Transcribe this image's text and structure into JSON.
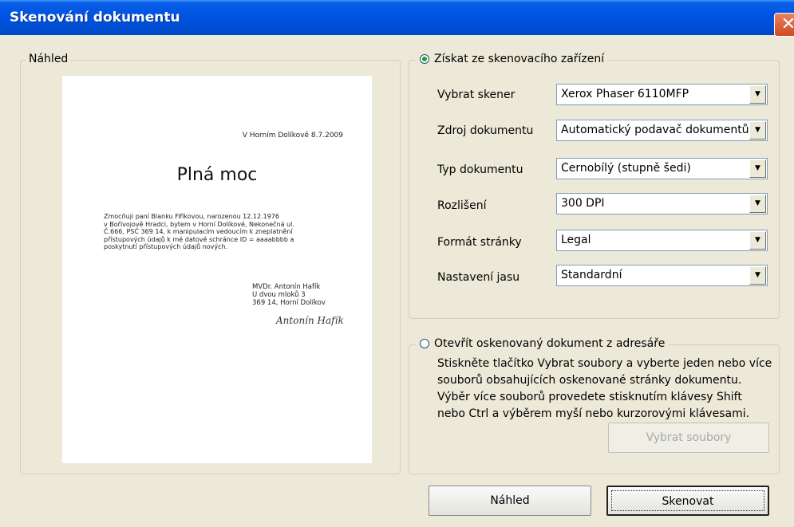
{
  "window": {
    "title": "Skenování dokumentu",
    "close_symbol": "✕"
  },
  "preview": {
    "legend": "Náhled",
    "document": {
      "date_line": "V Horním Dolíkově 8.7.2009",
      "title": "Plná moc",
      "body_lines": [
        "Zmocňuji paní Blanku Fifíkovou, narozenou 12.12.1976",
        "v Bořivojově Hradci, bytem v Horní Dolíkové, Nekonečná ul.",
        "Č.666, PSČ 369 14, k manipulacím vedoucím k zneplatnění",
        "přístupových údajů k mé datové schránce ID = aaaabbbb a",
        "poskytnutí přístupových údajů nových."
      ],
      "signature_lines": [
        "MVDr. Antonín Hafík",
        "U dvou mloků 3",
        "369 14, Horní Dolíkov"
      ],
      "handwritten_signature": "Antonín Hafík"
    }
  },
  "scanner_group": {
    "legend": "Získat ze skenovacího zařízení",
    "selected": true,
    "fields": [
      {
        "label": "Vybrat skener",
        "value": "Xerox Phaser 6110MFP"
      },
      {
        "label": "Zdroj dokumentu",
        "value": "Automatický podavač dokumentů"
      },
      {
        "label": "Typ dokumentu",
        "value": "Černobílý (stupně šedi)"
      },
      {
        "label": "Rozlišení",
        "value": "300 DPI"
      },
      {
        "label": "Formát stránky",
        "value": "Legal"
      },
      {
        "label": "Nastavení jasu",
        "value": "Standardní"
      }
    ],
    "dropdown_arrow": "▼"
  },
  "folder_group": {
    "legend": "Otevřít oskenovaný dokument z adresáře",
    "selected": false,
    "description": "Stiskněte tlačítko Vybrat soubory a vyberte jeden nebo více souborů obsahujících oskenované stránky dokumentu. Výběr více souborů provedete stisknutím klávesy Shift nebo Ctrl a výběrem myší nebo kurzorovými klávesami.",
    "select_files_button": "Vybrat soubory"
  },
  "buttons": {
    "preview": "Náhled",
    "scan": "Skenovat"
  }
}
